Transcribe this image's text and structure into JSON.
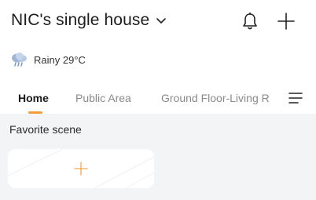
{
  "header": {
    "home_name": "NIC's single house"
  },
  "weather": {
    "text": "Rainy 29°C",
    "icon": "rain-cloud-icon"
  },
  "tabs": [
    {
      "label": "Home",
      "active": true
    },
    {
      "label": "Public Area",
      "active": false
    },
    {
      "label": "Ground Floor-Living R",
      "active": false
    }
  ],
  "favorites": {
    "title": "Favorite scene"
  },
  "colors": {
    "accent": "#f39c38",
    "background": "#f3f4f6"
  }
}
